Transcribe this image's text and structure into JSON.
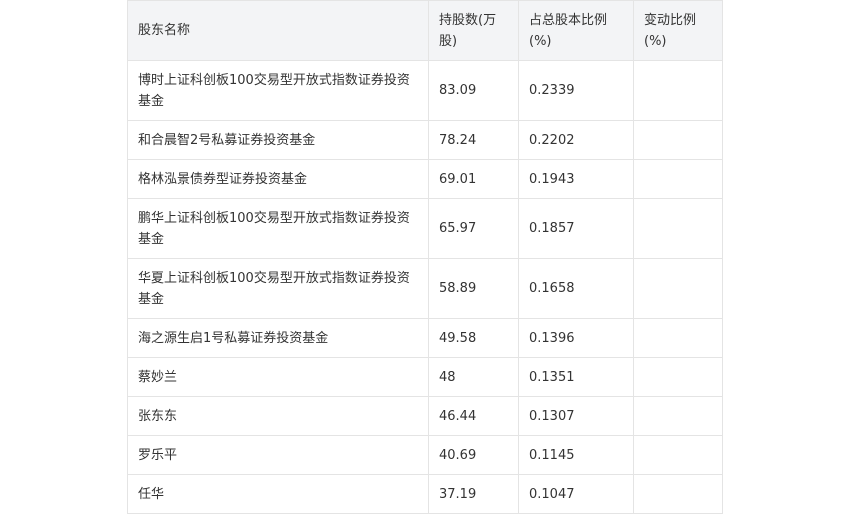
{
  "table": {
    "headers": [
      "股东名称",
      "持股数(万股)",
      "占总股本比例(%)",
      "变动比例(%)"
    ],
    "rows": [
      {
        "name": "博时上证科创板100交易型开放式指数证券投资基金",
        "shares": "83.09",
        "ratio": "0.2339",
        "change": ""
      },
      {
        "name": "和合晨智2号私募证券投资基金",
        "shares": "78.24",
        "ratio": "0.2202",
        "change": ""
      },
      {
        "name": "格林泓景债券型证券投资基金",
        "shares": "69.01",
        "ratio": "0.1943",
        "change": ""
      },
      {
        "name": "鹏华上证科创板100交易型开放式指数证券投资基金",
        "shares": "65.97",
        "ratio": "0.1857",
        "change": ""
      },
      {
        "name": "华夏上证科创板100交易型开放式指数证券投资基金",
        "shares": "58.89",
        "ratio": "0.1658",
        "change": ""
      },
      {
        "name": "海之源生启1号私募证券投资基金",
        "shares": "49.58",
        "ratio": "0.1396",
        "change": ""
      },
      {
        "name": "蔡妙兰",
        "shares": "48",
        "ratio": "0.1351",
        "change": ""
      },
      {
        "name": "张东东",
        "shares": "46.44",
        "ratio": "0.1307",
        "change": ""
      },
      {
        "name": "罗乐平",
        "shares": "40.69",
        "ratio": "0.1145",
        "change": ""
      },
      {
        "name": "任华",
        "shares": "37.19",
        "ratio": "0.1047",
        "change": ""
      }
    ]
  }
}
